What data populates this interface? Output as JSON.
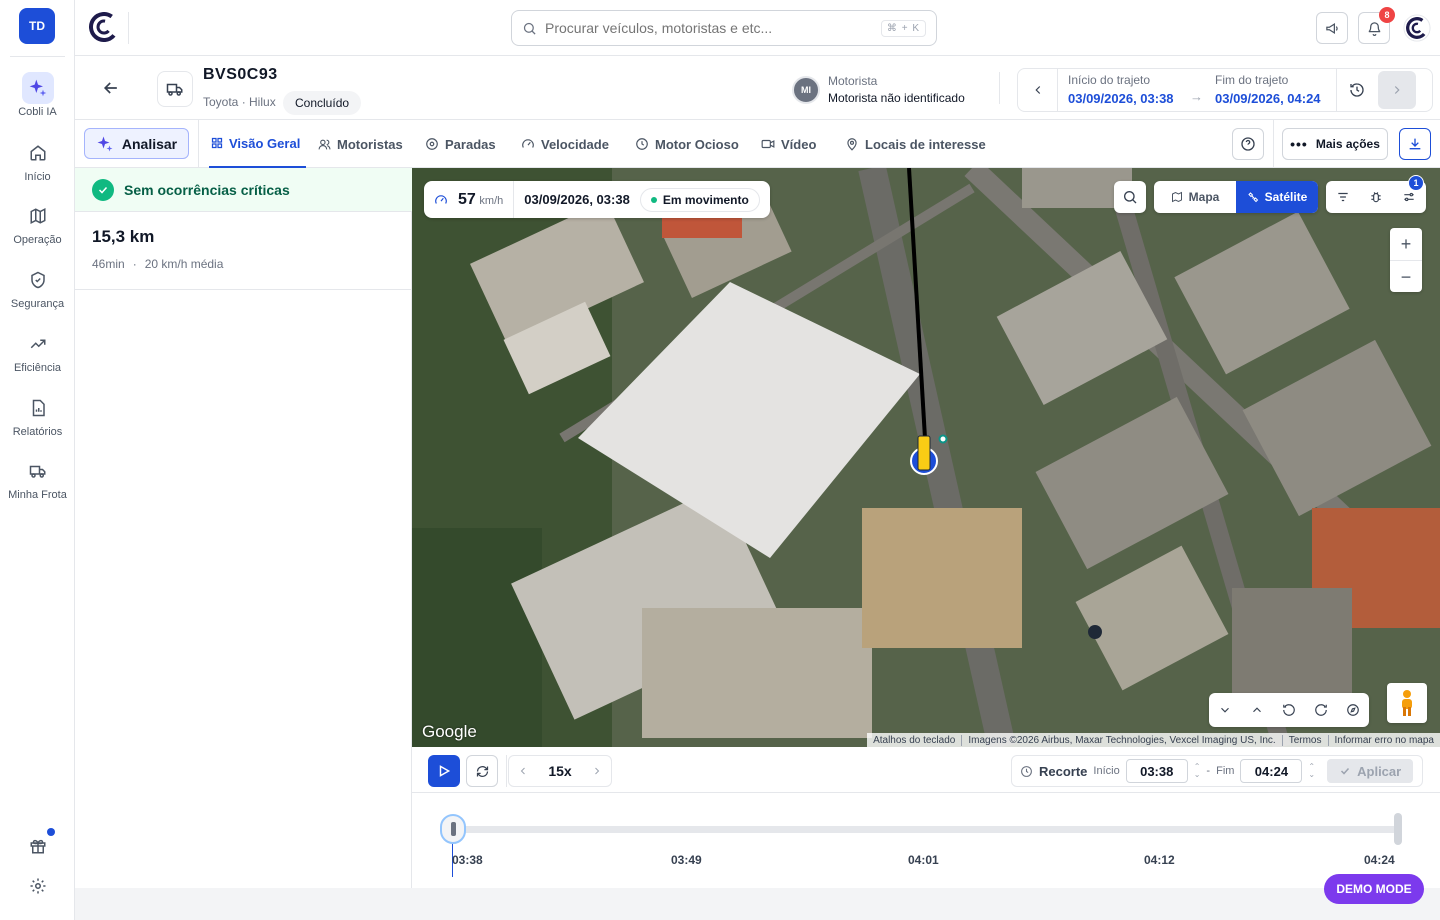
{
  "user": {
    "initials": "TD"
  },
  "nav": {
    "items": [
      {
        "label": "Cobli IA",
        "icon": "sparkles-icon"
      },
      {
        "label": "Início",
        "icon": "home-icon"
      },
      {
        "label": "Operação",
        "icon": "map-icon"
      },
      {
        "label": "Segurança",
        "icon": "shield-icon"
      },
      {
        "label": "Eficiência",
        "icon": "trending-up-icon"
      },
      {
        "label": "Relatórios",
        "icon": "report-icon"
      },
      {
        "label": "Minha Frota",
        "icon": "truck-icon"
      }
    ]
  },
  "topbar": {
    "search_placeholder": "Procurar veículos, motoristas e etc...",
    "search_shortcut": "⌘ + K",
    "notifications_count": "8"
  },
  "vehicle": {
    "plate": "BVS0C93",
    "model": "Toyota · Hilux",
    "status": "Concluído",
    "driver_initials": "MI",
    "driver_label": "Motorista",
    "driver_name": "Motorista não identificado"
  },
  "trip": {
    "start_label": "Início do trajeto",
    "start_value": "03/09/2026, 03:38",
    "end_label": "Fim do trajeto",
    "end_value": "03/09/2026, 04:24"
  },
  "tabs": {
    "analyze_label": "Analisar",
    "items": [
      {
        "label": "Visão Geral",
        "active": true
      },
      {
        "label": "Motoristas"
      },
      {
        "label": "Paradas"
      },
      {
        "label": "Velocidade"
      },
      {
        "label": "Motor Ocioso"
      },
      {
        "label": "Vídeo"
      },
      {
        "label": "Locais de interesse"
      }
    ],
    "more_label": "Mais ações"
  },
  "summary": {
    "critical_status": "Sem ocorrências críticas",
    "distance": "15,3 km",
    "duration": "46min",
    "avg_speed": "20 km/h média"
  },
  "map": {
    "speed_value": "57",
    "speed_unit": "km/h",
    "timestamp": "03/09/2026, 03:38",
    "moving_status": "Em movimento",
    "type_map": "Mapa",
    "type_satellite": "Satélite",
    "filters_badge": "1",
    "google": "Google",
    "attribution": [
      "Atalhos do teclado",
      "Imagens ©2026 Airbus, Maxar Technologies, Vexcel Imaging US, Inc.",
      "Termos",
      "Informar erro no mapa"
    ]
  },
  "playback": {
    "speed": "15x",
    "recorte_label": "Recorte",
    "start_label": "Início",
    "start_value": "03:38",
    "end_label": "Fim",
    "end_value": "04:24",
    "apply_label": "Aplicar",
    "progress": 0
  },
  "timeline": {
    "ticks": [
      "03:38",
      "03:49",
      "04:01",
      "04:12",
      "04:24"
    ]
  },
  "demo_label": "DEMO MODE",
  "colors": {
    "accent": "#1d4ed8",
    "success": "#10b981",
    "danger": "#ef4444",
    "demo": "#7c3aed"
  }
}
